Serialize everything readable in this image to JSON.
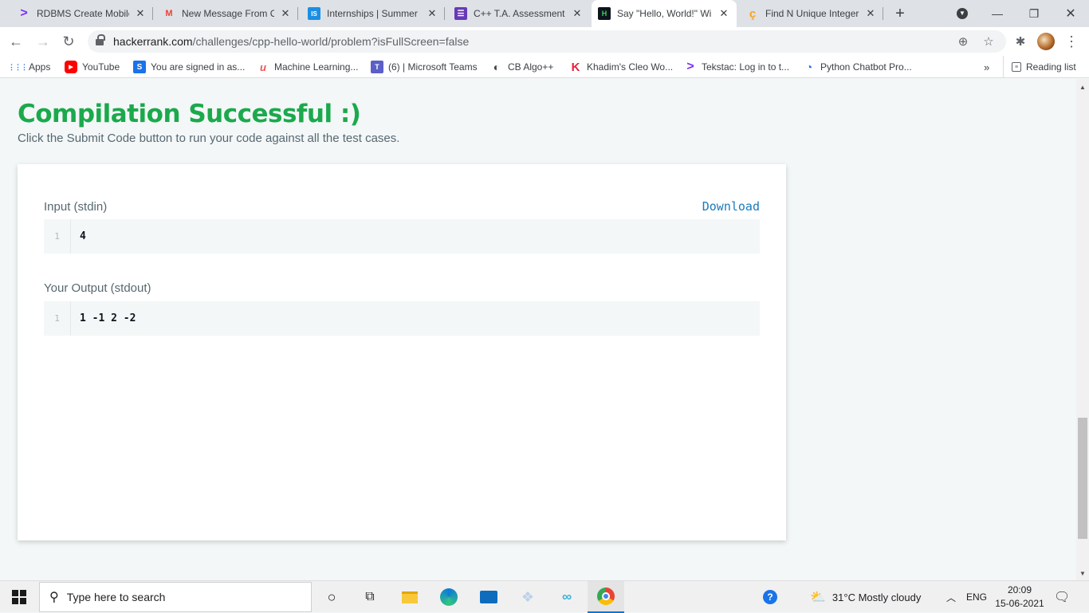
{
  "tabs": [
    {
      "title": "RDBMS Create Mobile",
      "icon": "gt-icon",
      "fav": ">",
      "favColor": "#7b2ff7"
    },
    {
      "title": "New Message From Co",
      "icon": "gmail-icon",
      "fav": "M",
      "favColor": "#ea4335"
    },
    {
      "title": "Internships | Summer I",
      "icon": "internshala-icon",
      "fav": "IS",
      "favColor": "#1a8fe3"
    },
    {
      "title": "C++ T.A. Assessment -",
      "icon": "forms-icon",
      "fav": "☰",
      "favColor": "#673ab7"
    },
    {
      "title": "Say \"Hello, World!\" Wi",
      "icon": "hackerrank-icon",
      "fav": "H",
      "favColor": "#0e141e"
    },
    {
      "title": "Find N Unique Integer",
      "icon": "leetcode-icon",
      "fav": "ç",
      "favColor": "#ffa116"
    }
  ],
  "toolbar": {
    "url_host": "hackerrank.com",
    "url_path": "/challenges/cpp-hello-world/problem?isFullScreen=false"
  },
  "bookmarks": [
    {
      "label": "Apps",
      "icon": "apps-grid-icon",
      "fav": "⋮⋮",
      "color": "#1a73e8"
    },
    {
      "label": "YouTube",
      "icon": "youtube-icon",
      "fav": "▶",
      "color": "#ff0000"
    },
    {
      "label": "You are signed in as...",
      "icon": "s-icon",
      "fav": "S",
      "color": "#1a73e8"
    },
    {
      "label": "Machine Learning...",
      "icon": "udemy-icon",
      "fav": "u",
      "color": "#ec5252"
    },
    {
      "label": "(6) | Microsoft Teams",
      "icon": "teams-icon",
      "fav": "T",
      "color": "#5b5fc7"
    },
    {
      "label": "CB Algo++",
      "icon": "cb-icon",
      "fav": "◐",
      "color": "#444"
    },
    {
      "label": "Khadim's Cleo Wo...",
      "icon": "k-icon",
      "fav": "K",
      "color": "#e8233b"
    },
    {
      "label": "Tekstac: Log in to t...",
      "icon": "tekstac-icon",
      "fav": ">",
      "color": "#7b2ff7"
    },
    {
      "label": "Python Chatbot Pro...",
      "icon": "chatbot-icon",
      "fav": "◔",
      "color": "#1a73e8"
    }
  ],
  "reading_list": "Reading list",
  "page": {
    "title": "Compilation Successful :)",
    "subtitle": "Click the Submit Code button to run your code against all the test cases.",
    "input_label": "Input (stdin)",
    "download": "Download",
    "input_line_no": "1",
    "input_code": "4",
    "output_label": "Your Output (stdout)",
    "output_line_no": "1",
    "output_code": "1 -1 2 -2"
  },
  "taskbar": {
    "search_placeholder": "Type here to search",
    "weather": "31°C  Mostly cloudy",
    "lang": "ENG",
    "time": "20:09",
    "date": "15-06-2021"
  },
  "colors": {
    "success": "#1ba94c",
    "link": "#1a7bbd",
    "text_muted": "#576871"
  }
}
